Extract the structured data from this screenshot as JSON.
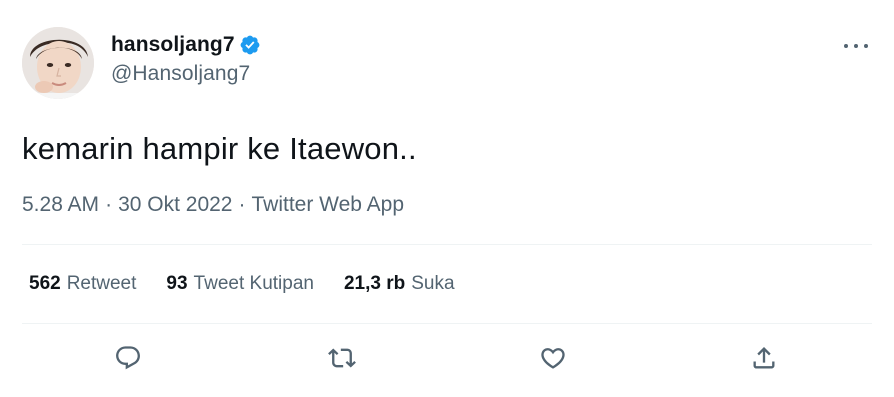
{
  "user": {
    "display_name": "hansoljang7",
    "handle": "@Hansoljang7",
    "verified": true
  },
  "tweet": {
    "text": "kemarin hampir ke Itaewon.."
  },
  "meta": {
    "time": "5.28 AM",
    "separator": "·",
    "date": "30 Okt 2022",
    "source": "Twitter Web App"
  },
  "stats": {
    "retweets": {
      "count": "562",
      "label": "Retweet"
    },
    "quotes": {
      "count": "93",
      "label": "Tweet Kutipan"
    },
    "likes": {
      "count": "21,3 rb",
      "label": "Suka"
    }
  },
  "icons": {
    "more": "more-horizontal-icon",
    "reply": "reply-icon",
    "retweet": "retweet-icon",
    "like": "heart-icon",
    "share": "share-icon",
    "verified": "verified-badge-icon"
  },
  "colors": {
    "text": "#0f1419",
    "secondary": "#536471",
    "verified": "#1d9bf0",
    "divider": "#eff3f4"
  }
}
